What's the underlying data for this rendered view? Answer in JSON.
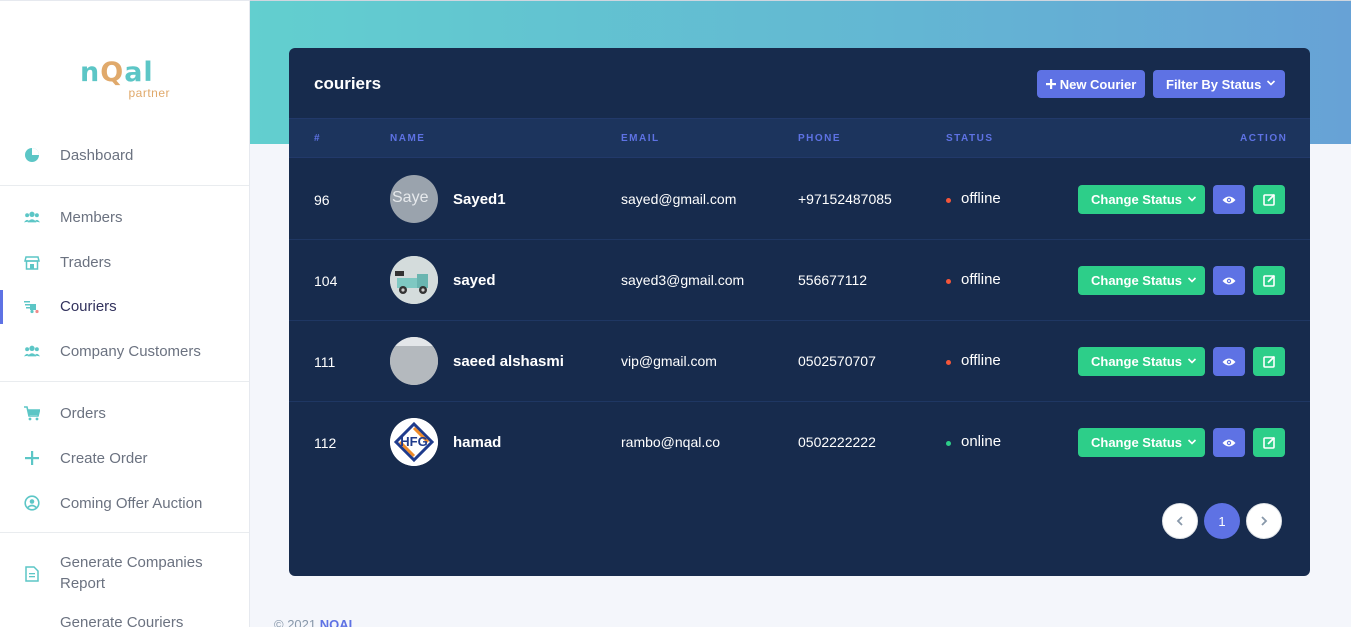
{
  "sidebar": {
    "logo": {
      "brand_a": "n",
      "brand_q": "Q",
      "brand_b": "al",
      "sub": "partner"
    },
    "items": [
      {
        "label": "Dashboard",
        "icon": "pie-chart-icon"
      },
      {
        "label": "Members",
        "icon": "users-icon"
      },
      {
        "label": "Traders",
        "icon": "store-icon"
      },
      {
        "label": "Couriers",
        "icon": "delivery-truck-icon",
        "active": true
      },
      {
        "label": "Company Customers",
        "icon": "users-icon"
      },
      {
        "label": "Orders",
        "icon": "cart-icon"
      },
      {
        "label": "Create Order",
        "icon": "plus-icon"
      },
      {
        "label": "Coming Offer Auction",
        "icon": "user-circle-icon"
      },
      {
        "label": "Generate Companies Report",
        "icon": "document-icon"
      },
      {
        "label": "Generate Couriers",
        "icon": "document-icon"
      }
    ]
  },
  "card": {
    "title": "couriers",
    "new_button": "New Courier",
    "filter_button": "Filter By Status"
  },
  "table": {
    "headers": [
      "#",
      "NAME",
      "EMAIL",
      "PHONE",
      "STATUS",
      "ACTION"
    ],
    "rows": [
      {
        "id": "96",
        "name": "Sayed1",
        "email": "sayed@gmail.com",
        "phone": "+97152487085",
        "status": "offline",
        "avatar_alt": "Saye"
      },
      {
        "id": "104",
        "name": "sayed",
        "email": "sayed3@gmail.com",
        "phone": "556677112",
        "status": "offline"
      },
      {
        "id": "111",
        "name": "saeed alshasmi",
        "email": "vip@gmail.com",
        "phone": "0502570707",
        "status": "offline"
      },
      {
        "id": "112",
        "name": "hamad",
        "email": "rambo@nqal.co",
        "phone": "0502222222",
        "status": "online",
        "avatar_text": "HFG"
      }
    ],
    "change_status_label": "Change Status"
  },
  "pagination": {
    "current": "1",
    "prev": "‹",
    "next": "›"
  },
  "footer": {
    "copyright": "© 2021",
    "brand": "NQAL"
  },
  "colors": {
    "primary": "#5e72e4",
    "success": "#2dce89",
    "offline": "#f5563a",
    "online": "#2dce89",
    "card": "#172b4d"
  }
}
